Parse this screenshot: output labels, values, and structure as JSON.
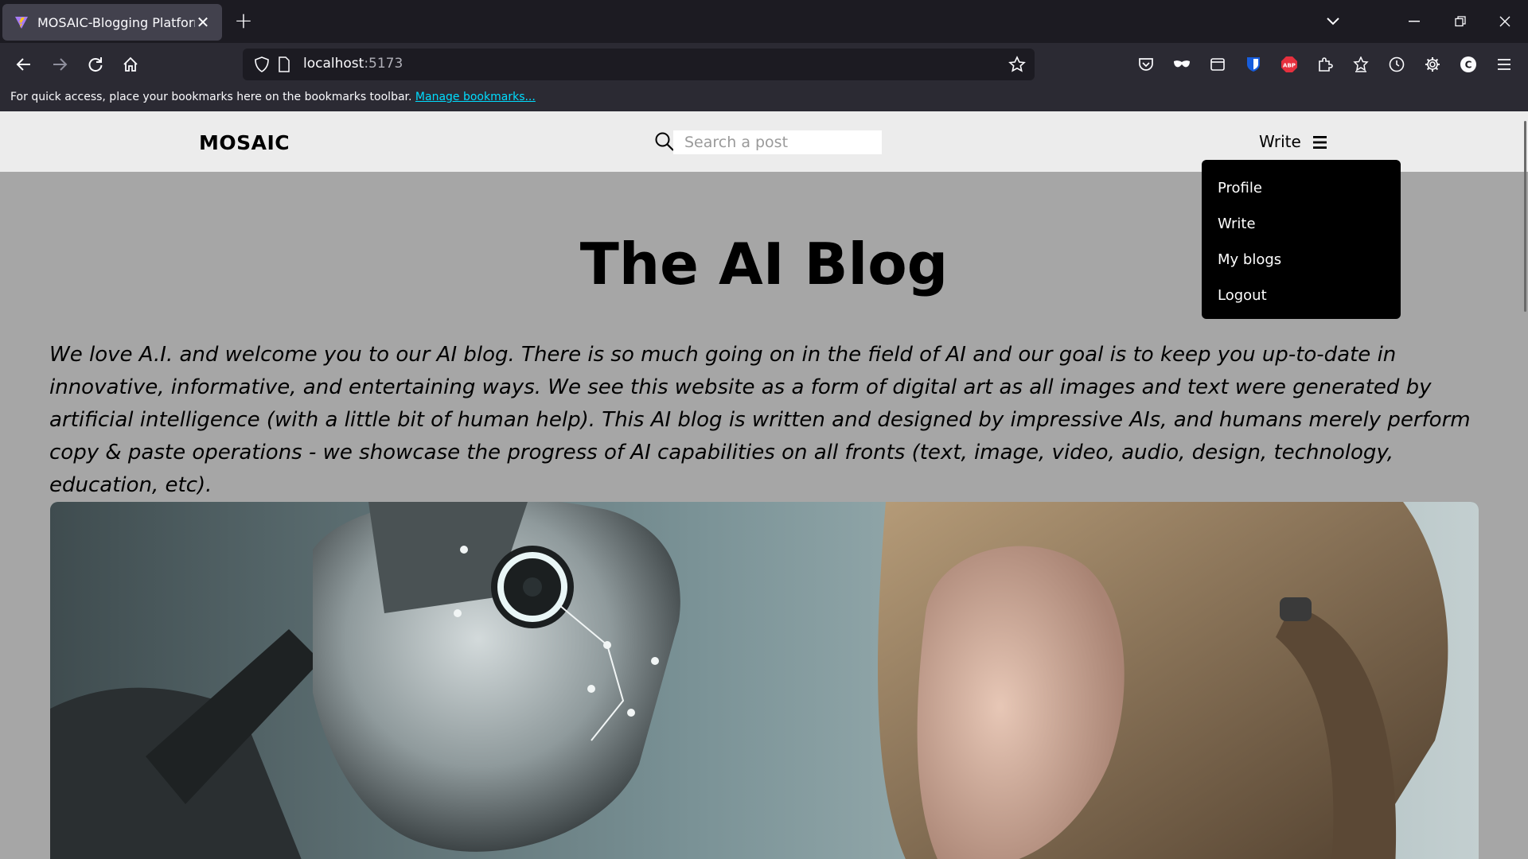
{
  "browser": {
    "tab_title": "MOSAIC-Blogging Platform",
    "tab_favicon": "vite-icon",
    "url_host": "localhost",
    "url_port": ":5173",
    "bookmarks_message": "For quick access, place your bookmarks here on the bookmarks toolbar.",
    "bookmarks_link": "Manage bookmarks...",
    "account_initial": "C",
    "theme": {
      "chrome_dark": "#1c1b22",
      "toolbar": "#2b2a33",
      "link": "#00ddff"
    }
  },
  "site": {
    "logo": "MOSAIC",
    "search_placeholder": "Search a post",
    "write_label": "Write",
    "menu": {
      "items": [
        {
          "label": "Profile"
        },
        {
          "label": "Write"
        },
        {
          "label": "My blogs"
        },
        {
          "label": "Logout"
        }
      ]
    },
    "colors": {
      "header_bg": "#ececec",
      "page_bg": "#a6a6a6",
      "dropdown_bg": "#000000"
    }
  },
  "main": {
    "title": "The AI Blog",
    "intro": "We love A.I. and welcome you to our AI blog. There is so much going on in the field of AI and our goal is to keep you up-to-date in innovative, informative, and entertaining ways. We see this website as a form of digital art as all images and text were generated by artificial intelligence (with a little bit of human help). This AI blog is written and designed by impressive AIs, and humans merely perform copy & paste operations - we showcase the progress of AI capabilities on all fronts (text, image, video, audio, design, technology, education, etc)."
  }
}
